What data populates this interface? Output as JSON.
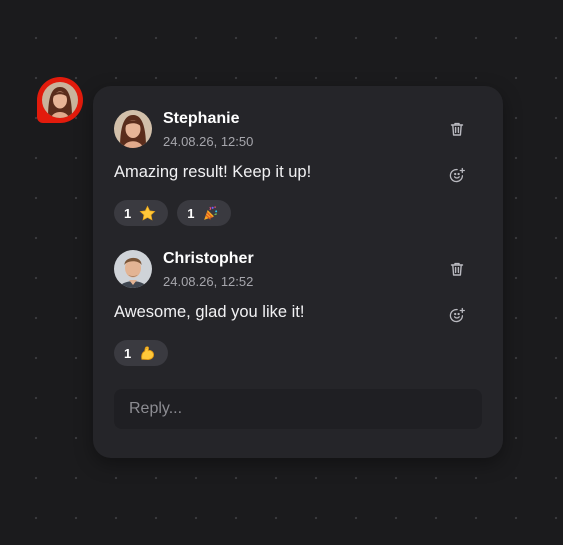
{
  "pin": {
    "icon": "comment-pin-icon",
    "color": "#e21b0c"
  },
  "comments": [
    {
      "author": "Stephanie",
      "timestamp": "24.08.26, 12:50",
      "text": "Amazing result! Keep it up!",
      "reactions": [
        {
          "count": "1",
          "emoji": "⭐",
          "icon": "star-icon"
        },
        {
          "count": "1",
          "emoji": "🎉",
          "icon": "party-popper-icon"
        }
      ]
    },
    {
      "author": "Christopher",
      "timestamp": "24.08.26, 12:52",
      "text": "Awesome, glad you like it!",
      "reactions": [
        {
          "count": "1",
          "emoji": "💪",
          "icon": "flexed-biceps-icon"
        }
      ]
    }
  ],
  "reply": {
    "placeholder": "Reply..."
  },
  "colors": {
    "background": "#1b1b1d",
    "card": "#252529",
    "chip": "#3a3a40",
    "input": "#1f1f23",
    "muted_text": "#a6a6ac",
    "accent": "#e21b0c"
  }
}
